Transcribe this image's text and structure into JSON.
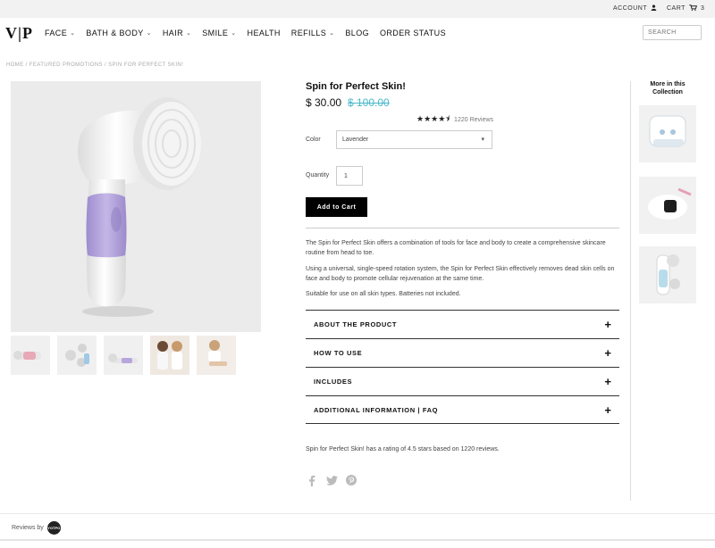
{
  "topbar": {
    "account_label": "ACCOUNT",
    "account_icon": "user-icon",
    "cart_label": "CART",
    "cart_icon": "cart-icon",
    "cart_count": "3"
  },
  "header": {
    "logo": "V|P",
    "nav": [
      {
        "label": "FACE",
        "dropdown": true
      },
      {
        "label": "BATH & BODY",
        "dropdown": true
      },
      {
        "label": "HAIR",
        "dropdown": true
      },
      {
        "label": "SMILE",
        "dropdown": true
      },
      {
        "label": "HEALTH",
        "dropdown": false
      },
      {
        "label": "REFILLS",
        "dropdown": true
      },
      {
        "label": "BLOG",
        "dropdown": false
      },
      {
        "label": "ORDER STATUS",
        "dropdown": false
      }
    ],
    "search_placeholder": "SEARCH"
  },
  "breadcrumb": "HOME / FEATURED PROMOTIONS / SPIN FOR PERFECT SKIN!",
  "product": {
    "title": "Spin for Perfect Skin!",
    "price": "$ 30.00",
    "compare_price": "$ 100.00",
    "rating_value": 4.5,
    "stars": "★★★★⯨",
    "review_count": "1220 Reviews",
    "color_label": "Color",
    "color_value": "Lavender",
    "quantity_label": "Quantity",
    "quantity_value": "1",
    "add_to_cart": "Add to Cart",
    "description": [
      "The Spin for Perfect Skin offers a combination of tools for face and body to create a comprehensive skincare routine from head to toe.",
      "Using a universal, single-speed rotation system, the Spin for Perfect Skin effectively removes dead skin cells on face and body to promote cellular rejuvenation at the same time.",
      "Suitable for use on all skin types. Batteries not included."
    ],
    "accordions": [
      {
        "label": "ABOUT THE PRODUCT"
      },
      {
        "label": "HOW TO USE"
      },
      {
        "label": "INCLUDES"
      },
      {
        "label": "ADDITIONAL INFORMATION | FAQ"
      }
    ],
    "accordion_icon": "plus-icon",
    "rating_summary": "Spin for Perfect Skin! has a rating of 4.5 stars based on 1220 reviews.",
    "social": [
      "facebook-icon",
      "twitter-icon",
      "pinterest-icon"
    ]
  },
  "sidebar": {
    "title": "More in this Collection"
  },
  "footer": {
    "reviews_by": "Reviews by",
    "badge_text": "YOTPO"
  },
  "colors": {
    "accent": "#49b8c9",
    "lavender": "#b6a6dc",
    "button": "#000000"
  }
}
